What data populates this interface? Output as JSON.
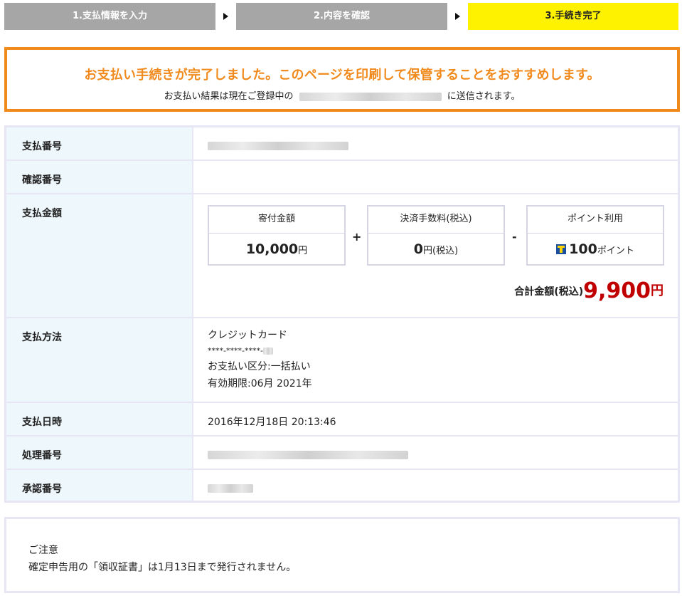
{
  "steps": [
    {
      "label": "1.支払情報を入力"
    },
    {
      "label": "2.内容を確認"
    },
    {
      "label": "3.手続き完了"
    }
  ],
  "notice": {
    "title": "お支払い手続きが完了しました。このページを印刷して保管することをおすすめします。",
    "sub_before": "お支払い結果は現在ご登録中の",
    "sub_after": "に送信されます。"
  },
  "rows": {
    "payment_number": {
      "label": "支払番号"
    },
    "confirmation_number": {
      "label": "確認番号"
    },
    "amount": {
      "label": "支払金額",
      "donation_label": "寄付金額",
      "donation_value": "10,000",
      "donation_unit": "円",
      "fee_label": "決済手数料(税込)",
      "fee_value": "0",
      "fee_unit": "円(税込)",
      "point_label": "ポイント利用",
      "point_value": "100",
      "point_unit": "ポイント",
      "plus": "+",
      "minus": "-",
      "total_label": "合計金額(税込)",
      "total_value": "9,900",
      "total_unit": "円"
    },
    "method": {
      "label": "支払方法",
      "type": "クレジットカード",
      "card": "****-****-****-",
      "division": "お支払い区分:一括払い",
      "expiry": "有効期限:06月 2021年"
    },
    "datetime": {
      "label": "支払日時",
      "value": "2016年12月18日 20:13:46"
    },
    "process_number": {
      "label": "処理番号"
    },
    "approval_number": {
      "label": "承認番号"
    }
  },
  "caution": {
    "title": "ご注意",
    "text": "確定申告用の「領収証書」は1月13日まで発行されません。"
  },
  "colors": {
    "accent_orange": "#f08a1c",
    "active_step": "#fff200",
    "total_red": "#c00000"
  }
}
